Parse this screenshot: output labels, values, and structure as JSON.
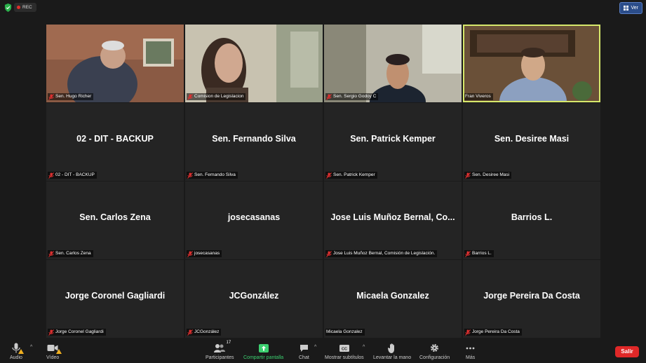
{
  "topbar": {
    "rec_label": "REC",
    "view_label": "Ver"
  },
  "tiles": [
    {
      "label": "Sen. Hugo Richer",
      "video": true
    },
    {
      "label": "Comision de Legislacion",
      "video": true
    },
    {
      "label": "Sen. Sergio Godoy C",
      "video": true
    },
    {
      "label": "Fran Viveros",
      "video": true,
      "active": true
    },
    {
      "name": "02 - DIT - BACKUP",
      "label": "02 - DIT - BACKUP",
      "muted": true
    },
    {
      "name": "Sen. Fernando Silva",
      "label": "Sen. Fernando Silva",
      "muted": true
    },
    {
      "name": "Sen. Patrick Kemper",
      "label": "Sen. Patrick Kemper",
      "muted": true
    },
    {
      "name": "Sen. Desiree Masi",
      "label": "Sen. Desiree Masi",
      "muted": true
    },
    {
      "name": "Sen. Carlos Zena",
      "label": "Sen. Carlos Zena",
      "muted": true
    },
    {
      "name": "josecasanas",
      "label": "josecasanas",
      "muted": true
    },
    {
      "name": "Jose Luis Muñoz Bernal, Co...",
      "label": "Jose Luis Muñoz Bernal, Comisión de Legislación.",
      "muted": true
    },
    {
      "name": "Barrios L.",
      "label": "Barrios L.",
      "muted": true
    },
    {
      "name": "Jorge Coronel Gagliardi",
      "label": "Jorge Coronel Gagliardi",
      "muted": true
    },
    {
      "name": "JCGonzález",
      "label": "JCGonzález",
      "muted": true
    },
    {
      "name": "Micaela Gonzalez",
      "label": "Micaela Gonzalez",
      "muted": false
    },
    {
      "name": "Jorge Pereira Da Costa",
      "label": "Jorge Pereira Da Costa",
      "muted": true
    }
  ],
  "toolbar": {
    "audio": "Audio",
    "video": "Vídeo",
    "participants": "Participantes",
    "participants_count": "17",
    "share": "Compartir pantalla",
    "chat": "Chat",
    "subtitles": "Mostrar subtítulos",
    "raise_hand": "Levantar la mano",
    "settings": "Configuración",
    "more": "Más",
    "exit": "Salir"
  },
  "colors": {
    "active_speaker": "#d6e86b",
    "share_green": "#3cd070",
    "exit_red": "#e02828"
  }
}
